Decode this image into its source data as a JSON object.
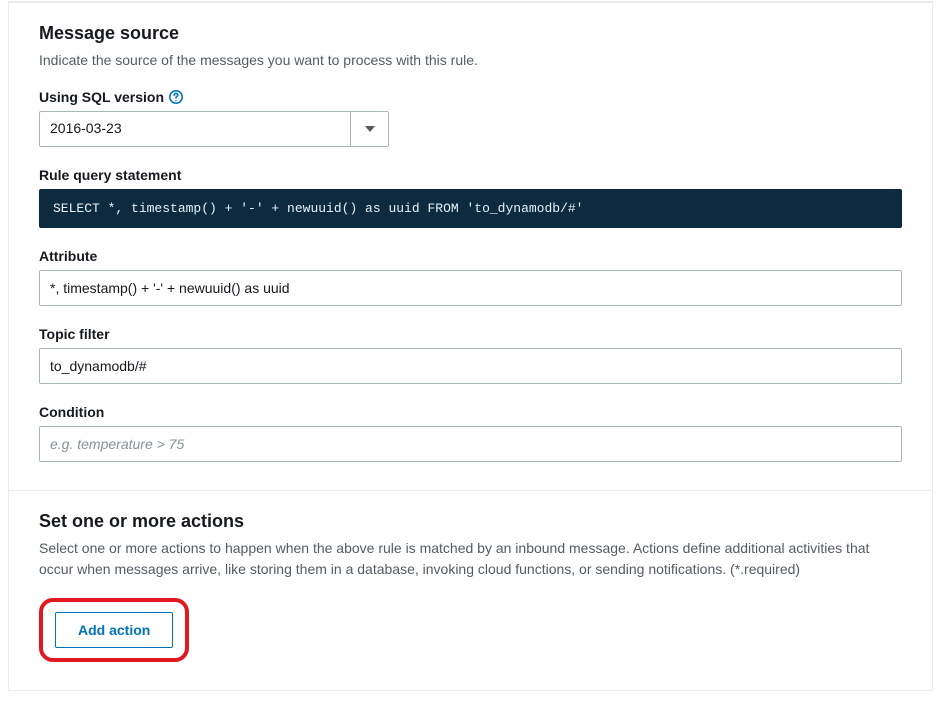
{
  "messageSource": {
    "title": "Message source",
    "description": "Indicate the source of the messages you want to process with this rule.",
    "sqlVersion": {
      "label": "Using SQL version",
      "value": "2016-03-23"
    },
    "ruleQuery": {
      "label": "Rule query statement",
      "code": "SELECT *, timestamp() + '-' + newuuid() as uuid FROM 'to_dynamodb/#'"
    },
    "attribute": {
      "label": "Attribute",
      "value": "*, timestamp() + '-' + newuuid() as uuid"
    },
    "topicFilter": {
      "label": "Topic filter",
      "value": "to_dynamodb/#"
    },
    "condition": {
      "label": "Condition",
      "value": "",
      "placeholder": "e.g. temperature > 75"
    }
  },
  "actions": {
    "title": "Set one or more actions",
    "description": "Select one or more actions to happen when the above rule is matched by an inbound message. Actions define additional activities that occur when messages arrive, like storing them in a database, invoking cloud functions, or sending notifications. (*.required)",
    "addButton": "Add action"
  }
}
